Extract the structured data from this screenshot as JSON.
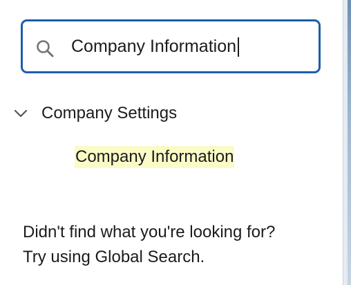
{
  "search": {
    "value": "Company Information",
    "icon": "search-icon"
  },
  "tree": {
    "section_label": "Company Settings",
    "section_icon": "chevron-down-icon",
    "items": [
      {
        "label": "Company Information",
        "highlight_color": "#fafbc6"
      }
    ]
  },
  "help": {
    "line1": "Didn't find what you're looking for?",
    "line2": "Try using Global Search."
  },
  "colors": {
    "focus_border": "#1b5ea8",
    "text": "#1b1b1b"
  }
}
